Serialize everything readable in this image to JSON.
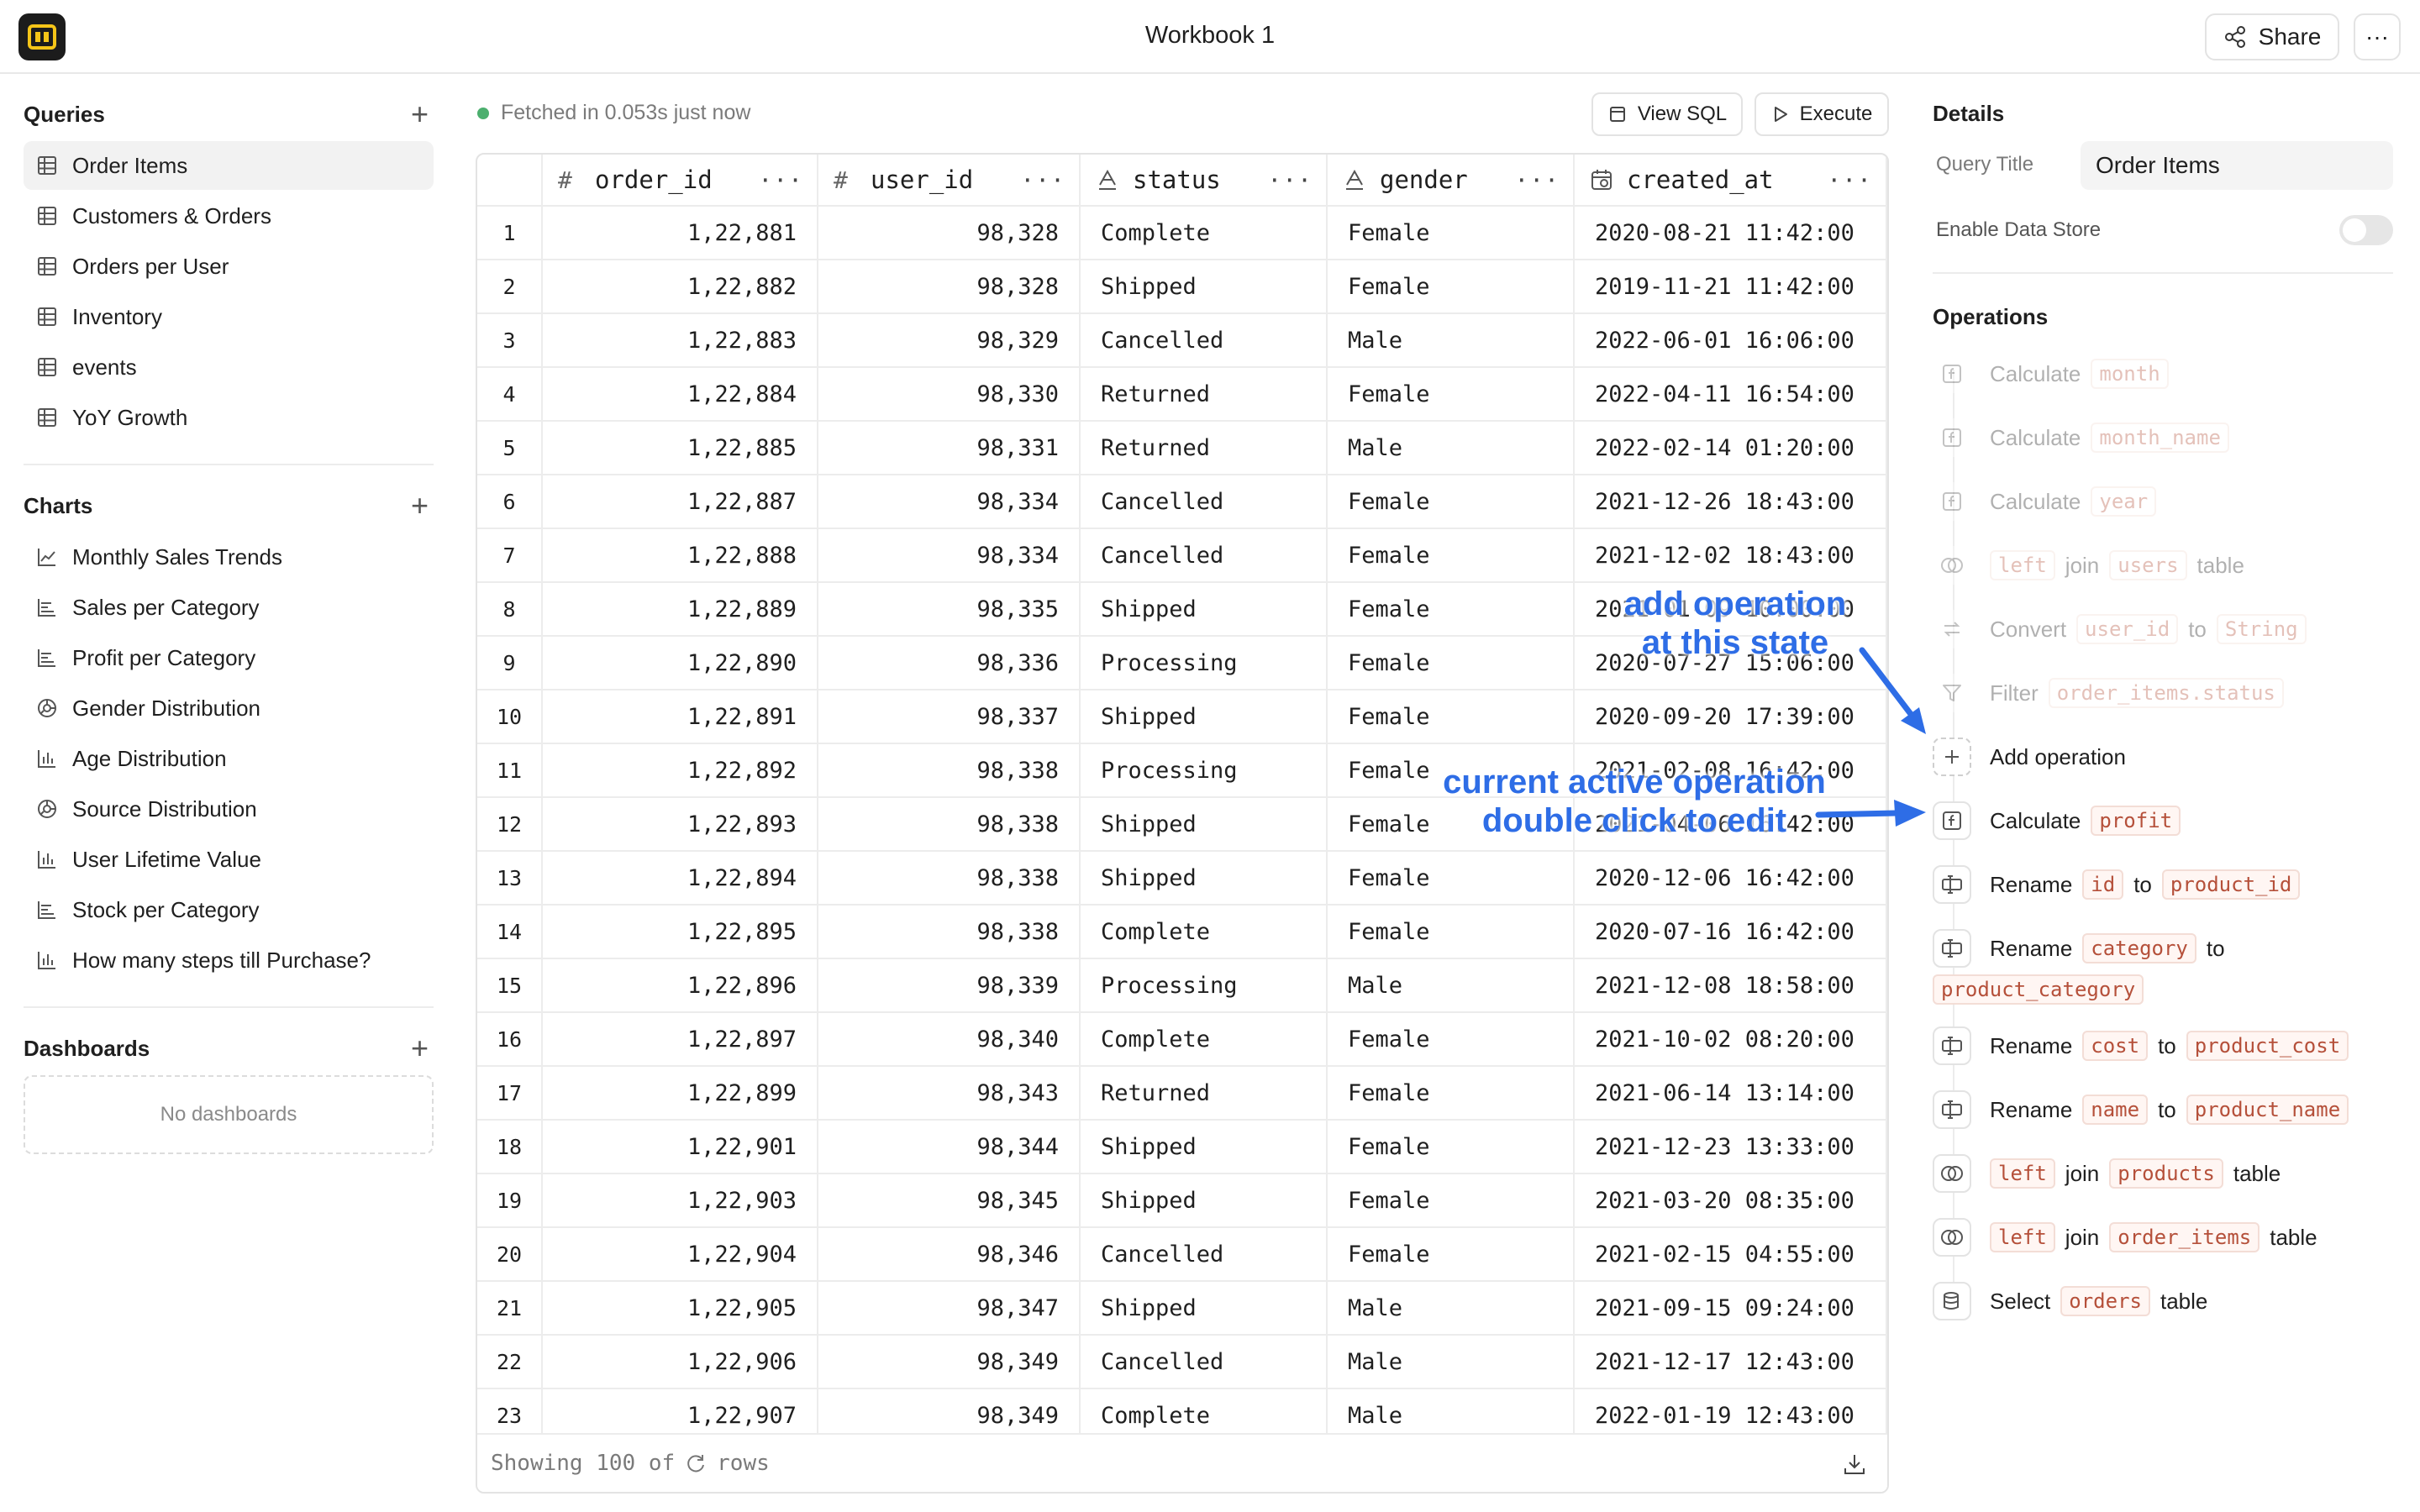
{
  "header": {
    "title": "Workbook 1",
    "share_label": "Share",
    "more_label": "···"
  },
  "sidebar": {
    "queries_label": "Queries",
    "queries": [
      {
        "label": "Order Items",
        "active": true
      },
      {
        "label": "Customers & Orders"
      },
      {
        "label": "Orders per User"
      },
      {
        "label": "Inventory"
      },
      {
        "label": "events"
      },
      {
        "label": "YoY Growth"
      }
    ],
    "charts_label": "Charts",
    "charts": [
      {
        "label": "Monthly Sales Trends",
        "icon": "line-chart-icon"
      },
      {
        "label": "Sales per Category",
        "icon": "bar-chart-horizontal-icon"
      },
      {
        "label": "Profit per Category",
        "icon": "bar-chart-horizontal-icon"
      },
      {
        "label": "Gender Distribution",
        "icon": "pie-chart-icon"
      },
      {
        "label": "Age Distribution",
        "icon": "bar-chart-icon"
      },
      {
        "label": "Source Distribution",
        "icon": "pie-chart-icon"
      },
      {
        "label": "User Lifetime Value",
        "icon": "bar-chart-icon"
      },
      {
        "label": "Stock per Category",
        "icon": "bar-chart-horizontal-icon"
      },
      {
        "label": "How many steps till Purchase?",
        "icon": "bar-chart-icon"
      }
    ],
    "dashboards_label": "Dashboards",
    "no_dashboards": "No dashboards"
  },
  "toolbar": {
    "fetched": "Fetched in 0.053s just now",
    "view_sql": "View SQL",
    "execute": "Execute"
  },
  "table": {
    "columns": [
      {
        "name": "order_id",
        "type": "#"
      },
      {
        "name": "user_id",
        "type": "#"
      },
      {
        "name": "status",
        "type": "A"
      },
      {
        "name": "gender",
        "type": "A"
      },
      {
        "name": "created_at",
        "type": "date"
      }
    ],
    "rows": [
      [
        "1",
        "1,22,881",
        "98,328",
        "Complete",
        "Female",
        "2020-08-21 11:42:00"
      ],
      [
        "2",
        "1,22,882",
        "98,328",
        "Shipped",
        "Female",
        "2019-11-21 11:42:00"
      ],
      [
        "3",
        "1,22,883",
        "98,329",
        "Cancelled",
        "Male",
        "2022-06-01 16:06:00"
      ],
      [
        "4",
        "1,22,884",
        "98,330",
        "Returned",
        "Female",
        "2022-04-11 16:54:00"
      ],
      [
        "5",
        "1,22,885",
        "98,331",
        "Returned",
        "Male",
        "2022-02-14 01:20:00"
      ],
      [
        "6",
        "1,22,887",
        "98,334",
        "Cancelled",
        "Female",
        "2021-12-26 18:43:00"
      ],
      [
        "7",
        "1,22,888",
        "98,334",
        "Cancelled",
        "Female",
        "2021-12-02 18:43:00"
      ],
      [
        "8",
        "1,22,889",
        "98,335",
        "Shipped",
        "Female",
        "2021-01-09 10:00:00"
      ],
      [
        "9",
        "1,22,890",
        "98,336",
        "Processing",
        "Female",
        "2020-07-27 15:06:00"
      ],
      [
        "10",
        "1,22,891",
        "98,337",
        "Shipped",
        "Female",
        "2020-09-20 17:39:00"
      ],
      [
        "11",
        "1,22,892",
        "98,338",
        "Processing",
        "Female",
        "2021-02-08 16:42:00"
      ],
      [
        "12",
        "1,22,893",
        "98,338",
        "Shipped",
        "Female",
        "2021-04-06 16:42:00"
      ],
      [
        "13",
        "1,22,894",
        "98,338",
        "Shipped",
        "Female",
        "2020-12-06 16:42:00"
      ],
      [
        "14",
        "1,22,895",
        "98,338",
        "Complete",
        "Female",
        "2020-07-16 16:42:00"
      ],
      [
        "15",
        "1,22,896",
        "98,339",
        "Processing",
        "Male",
        "2021-12-08 18:58:00"
      ],
      [
        "16",
        "1,22,897",
        "98,340",
        "Complete",
        "Female",
        "2021-10-02 08:20:00"
      ],
      [
        "17",
        "1,22,899",
        "98,343",
        "Returned",
        "Female",
        "2021-06-14 13:14:00"
      ],
      [
        "18",
        "1,22,901",
        "98,344",
        "Shipped",
        "Female",
        "2021-12-23 13:33:00"
      ],
      [
        "19",
        "1,22,903",
        "98,345",
        "Shipped",
        "Female",
        "2021-03-20 08:35:00"
      ],
      [
        "20",
        "1,22,904",
        "98,346",
        "Cancelled",
        "Female",
        "2021-02-15 04:55:00"
      ],
      [
        "21",
        "1,22,905",
        "98,347",
        "Shipped",
        "Male",
        "2021-09-15 09:24:00"
      ],
      [
        "22",
        "1,22,906",
        "98,349",
        "Cancelled",
        "Male",
        "2021-12-17 12:43:00"
      ],
      [
        "23",
        "1,22,907",
        "98,349",
        "Complete",
        "Male",
        "2022-01-19 12:43:00"
      ]
    ],
    "footer_pre": "Showing 100 of",
    "footer_post": "rows"
  },
  "details": {
    "title": "Details",
    "query_title_label": "Query Title",
    "query_title_value": "Order Items",
    "enable_data_store": "Enable Data Store",
    "operations_label": "Operations",
    "operations": [
      {
        "faded": true,
        "icon": "function-icon",
        "parts": [
          [
            "t",
            "Calculate"
          ],
          [
            "c",
            "month"
          ]
        ]
      },
      {
        "faded": true,
        "icon": "function-icon",
        "parts": [
          [
            "t",
            "Calculate"
          ],
          [
            "c",
            "month_name"
          ]
        ]
      },
      {
        "faded": true,
        "icon": "function-icon",
        "parts": [
          [
            "t",
            "Calculate"
          ],
          [
            "c",
            "year"
          ]
        ]
      },
      {
        "faded": true,
        "icon": "join-icon",
        "parts": [
          [
            "c",
            "left"
          ],
          [
            "t",
            "join"
          ],
          [
            "c",
            "users"
          ],
          [
            "t",
            "table"
          ]
        ]
      },
      {
        "faded": true,
        "icon": "convert-icon",
        "parts": [
          [
            "t",
            "Convert"
          ],
          [
            "c",
            "user_id"
          ],
          [
            "t",
            "to"
          ],
          [
            "c",
            "String"
          ]
        ]
      },
      {
        "faded": true,
        "icon": "filter-icon",
        "parts": [
          [
            "t",
            "Filter"
          ],
          [
            "c",
            "order_items.status"
          ]
        ]
      },
      {
        "faded": false,
        "icon": "plus-icon",
        "add": true,
        "parts": [
          [
            "t",
            "Add operation"
          ]
        ]
      },
      {
        "faded": false,
        "icon": "function-icon",
        "parts": [
          [
            "t",
            "Calculate"
          ],
          [
            "c",
            "profit"
          ]
        ]
      },
      {
        "faded": false,
        "icon": "rename-icon",
        "parts": [
          [
            "t",
            "Rename"
          ],
          [
            "c",
            "id"
          ],
          [
            "t",
            "to"
          ],
          [
            "c",
            "product_id"
          ]
        ]
      },
      {
        "faded": false,
        "icon": "rename-icon",
        "parts": [
          [
            "t",
            "Rename"
          ],
          [
            "c",
            "category"
          ],
          [
            "t",
            "to"
          ],
          [
            "c",
            "product_category"
          ]
        ]
      },
      {
        "faded": false,
        "icon": "rename-icon",
        "parts": [
          [
            "t",
            "Rename"
          ],
          [
            "c",
            "cost"
          ],
          [
            "t",
            "to"
          ],
          [
            "c",
            "product_cost"
          ]
        ]
      },
      {
        "faded": false,
        "icon": "rename-icon",
        "parts": [
          [
            "t",
            "Rename"
          ],
          [
            "c",
            "name"
          ],
          [
            "t",
            "to"
          ],
          [
            "c",
            "product_name"
          ]
        ]
      },
      {
        "faded": false,
        "icon": "join-icon",
        "parts": [
          [
            "c",
            "left"
          ],
          [
            "t",
            "join"
          ],
          [
            "c",
            "products"
          ],
          [
            "t",
            "table"
          ]
        ]
      },
      {
        "faded": false,
        "icon": "join-icon",
        "parts": [
          [
            "c",
            "left"
          ],
          [
            "t",
            "join"
          ],
          [
            "c",
            "order_items"
          ],
          [
            "t",
            "table"
          ]
        ]
      },
      {
        "faded": false,
        "icon": "database-icon",
        "parts": [
          [
            "t",
            "Select"
          ],
          [
            "c",
            "orders"
          ],
          [
            "t",
            "table"
          ]
        ]
      }
    ]
  },
  "annotations": {
    "add_op": "add operation\nat this state",
    "active_op": "current active operation\ndouble click to edit"
  }
}
